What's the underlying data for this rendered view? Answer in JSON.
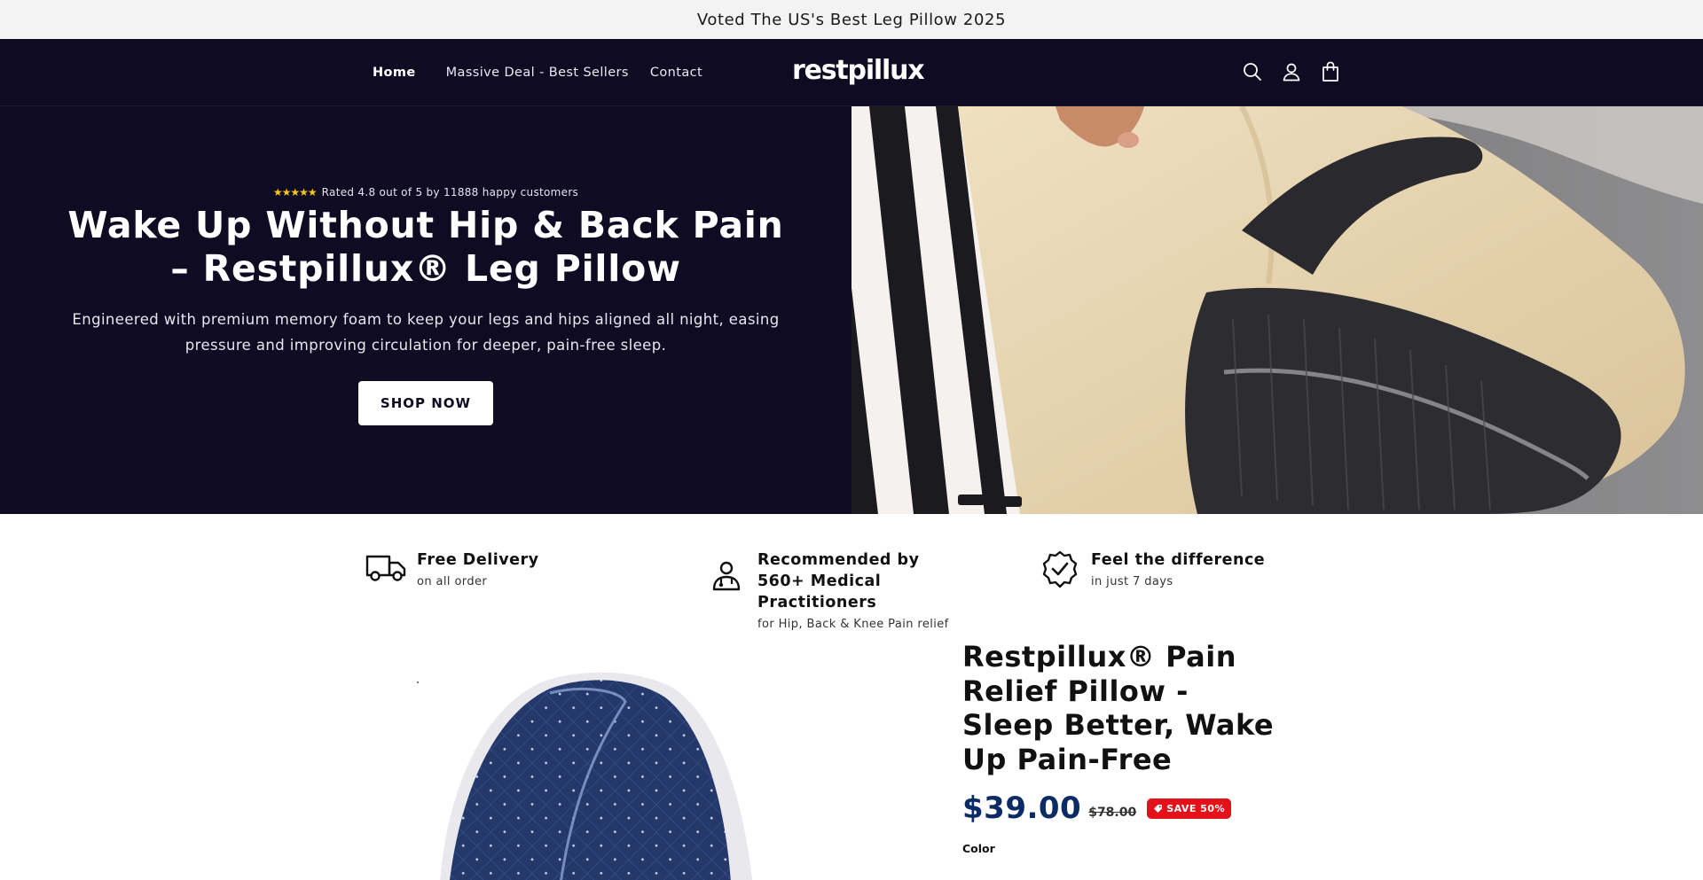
{
  "announcement": "Voted The US's Best Leg Pillow 2025",
  "header": {
    "nav": [
      "Home",
      "Massive Deal - Best Sellers",
      "Contact"
    ],
    "logo": "restpillux",
    "icons": [
      "search-icon",
      "account-icon",
      "cart-icon"
    ]
  },
  "hero": {
    "rating_text": "Rated 4.8 out of 5 by 11888 happy customers",
    "stars": "★★★★★",
    "title": "Wake Up Without Hip & Back Pain – Restpillux® Leg Pillow",
    "subtitle": "Engineered with premium memory foam to keep your legs and hips aligned all night, easing pressure and improving circulation for deeper, pain-free sleep.",
    "cta": "SHOP NOW"
  },
  "benefits": [
    {
      "title": "Free Delivery",
      "subtitle": "on all order",
      "icon": "truck-icon"
    },
    {
      "title": "Recommended by 560+ Medical Practitioners",
      "subtitle": "for Hip, Back & Knee Pain relief",
      "icon": "doctor-icon"
    },
    {
      "title": "Feel the difference",
      "subtitle": "in just 7 days",
      "icon": "badge-check-icon"
    }
  ],
  "product": {
    "title": "Restpillux® Pain Relief Pillow - Sleep Better, Wake Up Pain-Free",
    "price": "$39.00",
    "compare_price": "$78.00",
    "save_badge": "SAVE 50%",
    "color_label": "Color"
  },
  "colors": {
    "navy": "#0f0b23",
    "price_blue": "#0b2b66",
    "save_red": "#e4101a",
    "star_yellow": "#f7c51e"
  }
}
